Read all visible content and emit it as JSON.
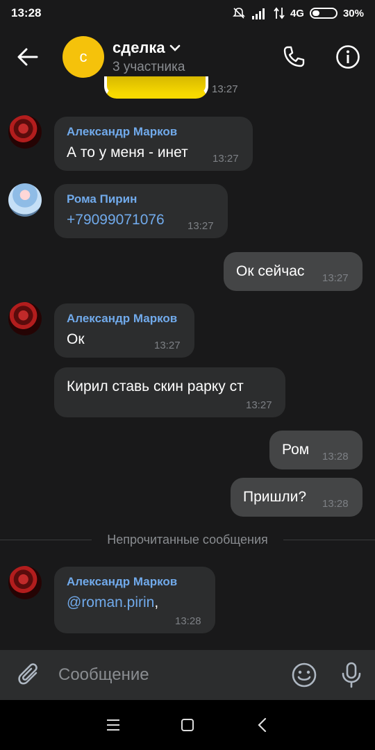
{
  "status_bar": {
    "time": "13:28",
    "network": "4G",
    "battery": "30%",
    "battery_level": 0.3
  },
  "header": {
    "avatar_letter": "с",
    "title": "сделка",
    "subtitle": "3 участника"
  },
  "sticker": {
    "time": "13:27"
  },
  "messages": [
    {
      "sender": "Александр Марков",
      "text": "А то у меня - инет",
      "time": "13:27"
    },
    {
      "sender": "Рома Пирин",
      "text": "+79099071076",
      "time": "13:27"
    },
    {
      "text": "Ок сейчас",
      "time": "13:27"
    },
    {
      "sender": "Александр Марков",
      "text": "Ок",
      "time": "13:27"
    },
    {
      "text": "Кирил ставь скин рарку ст",
      "time": "13:27"
    },
    {
      "text": "Ром",
      "time": "13:28"
    },
    {
      "text": "Пришли?",
      "time": "13:28"
    },
    {
      "sender": "Александр Марков",
      "text": "@roman.pirin",
      "suffix": ",",
      "time": "13:28"
    }
  ],
  "divider": {
    "label": "Непрочитанные сообщения"
  },
  "composer": {
    "placeholder": "Сообщение"
  },
  "colors": {
    "accent": "#71aaeb",
    "avatar_yellow": "#f5c20b",
    "bubble_in": "#2c2d2e",
    "bubble_out": "#444546",
    "background": "#19191a"
  },
  "icons": [
    "back-arrow-icon",
    "chevron-down-icon",
    "phone-icon",
    "info-icon",
    "paperclip-icon",
    "emoji-icon",
    "microphone-icon",
    "menu-icon",
    "home-square-icon",
    "back-chevron-icon",
    "mute-icon",
    "signal-icon"
  ]
}
